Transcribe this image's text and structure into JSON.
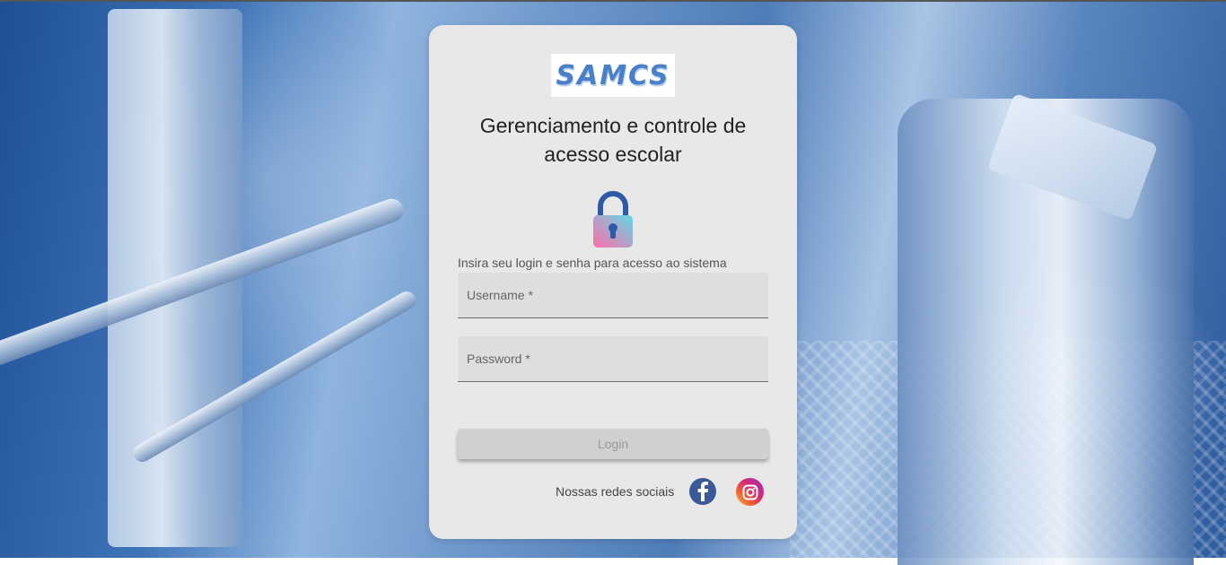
{
  "logo": {
    "text": "SAMCS"
  },
  "header": {
    "title": "Gerenciamento e controle de acesso escolar"
  },
  "form": {
    "instruction": "Insira seu login e senha para acesso ao sistema",
    "username_label": "Username *",
    "username_value": "",
    "password_label": "Password *",
    "password_value": "",
    "login_label": "Login"
  },
  "social": {
    "label": "Nossas redes sociais",
    "icons": [
      "facebook-icon",
      "instagram-icon"
    ]
  },
  "colors": {
    "card_bg": "#e8e8e8",
    "facebook": "#3b5998",
    "lock_top": "#2e5aa8",
    "lock_gradient_start": "#ff6fa8",
    "lock_gradient_end": "#63d6e8"
  }
}
